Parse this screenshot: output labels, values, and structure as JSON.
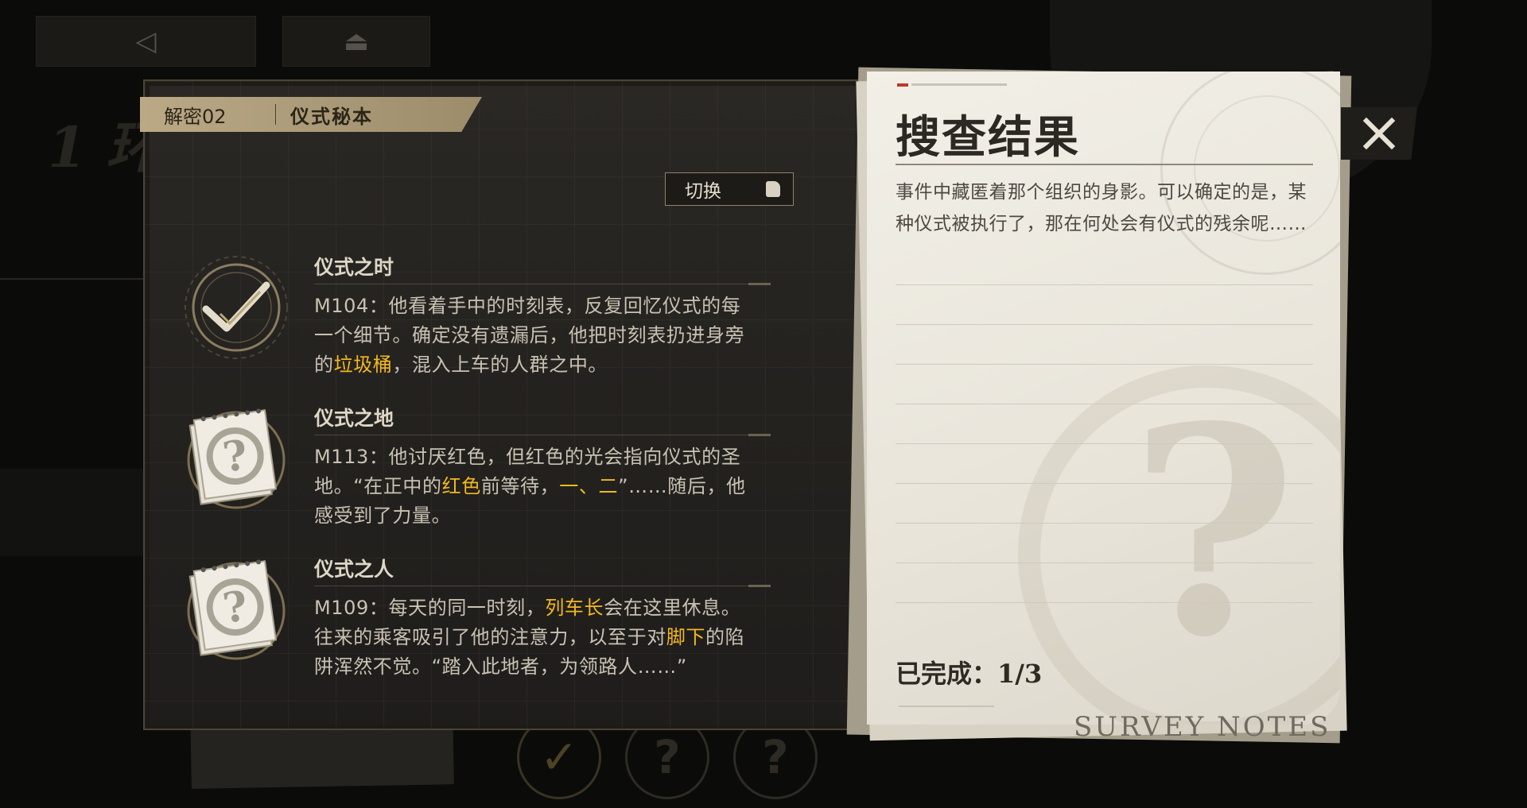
{
  "nav": {
    "back_glyph": "◁",
    "home_glyph": "⏏"
  },
  "ghost_title": "1 环",
  "panel": {
    "tag_number": "解密02",
    "tag_name": "仪式秘本",
    "switch_label": "切换"
  },
  "clues": [
    {
      "title": "仪式之时",
      "status": "solved",
      "text": [
        {
          "t": "M104：他看着手中的时刻表，反复回忆仪式的每一个细节。确定没有遗漏后，他把时刻表扔进身旁的",
          "h": false
        },
        {
          "t": "垃圾桶",
          "h": true
        },
        {
          "t": "，混入上车的人群之中。",
          "h": false
        }
      ]
    },
    {
      "title": "仪式之地",
      "status": "unknown",
      "text": [
        {
          "t": "M113：他讨厌红色，但红色的光会指向仪式的圣地。“在正中的",
          "h": false
        },
        {
          "t": "红色",
          "h": true
        },
        {
          "t": "前等待，",
          "h": false
        },
        {
          "t": "一、二",
          "h": true
        },
        {
          "t": "”……随后，他感受到了力量。",
          "h": false
        }
      ]
    },
    {
      "title": "仪式之人",
      "status": "unknown",
      "text": [
        {
          "t": "M109：每天的同一时刻，",
          "h": false
        },
        {
          "t": "列车长",
          "h": true
        },
        {
          "t": "会在这里休息。往来的乘客吸引了他的注意力，以至于对",
          "h": false
        },
        {
          "t": "脚下",
          "h": true
        },
        {
          "t": "的陷阱浑然不觉。“踏入此地者，为领路人……”",
          "h": false
        }
      ]
    }
  ],
  "notes": {
    "title": "搜查结果",
    "body": "事件中藏匿着那个组织的身影。可以确定的是，某种仪式被执行了，那在何处会有仪式的残余呢……",
    "completed_label": "已完成：",
    "completed_value": "1/3",
    "watermark": "SURVEY NOTES"
  },
  "colors": {
    "highlight": "#f2b820",
    "banner": "#bba986",
    "paper": "#f2efe7"
  },
  "icons": {
    "close": "close-icon",
    "check": "check-icon",
    "question": "question-icon",
    "switch": "switch-icon"
  }
}
